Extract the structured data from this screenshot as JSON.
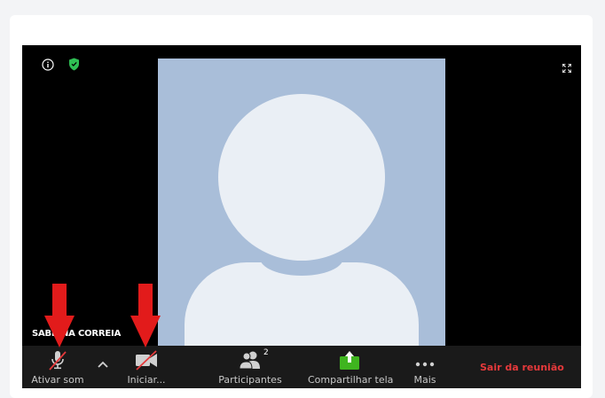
{
  "participant": {
    "name": "SABRINA CORREIA"
  },
  "toolbar": {
    "mute_label": "Ativar som",
    "video_label": "Iniciar...",
    "participants_label": "Participantes",
    "participants_count": "2",
    "share_label": "Compartilhar tela",
    "more_label": "Mais",
    "leave_label": "Sair da reunião"
  },
  "icons": [
    "info-icon",
    "shield-icon",
    "expand-icon",
    "microphone-off-icon",
    "chevron-up-icon",
    "video-off-icon",
    "participants-icon",
    "share-screen-icon",
    "more-icon",
    "red-arrow-icon"
  ],
  "colors": {
    "leave": "#e5393b",
    "share": "#3fb51f",
    "shield": "#2fbf54",
    "arrow": "#e21b1b"
  }
}
